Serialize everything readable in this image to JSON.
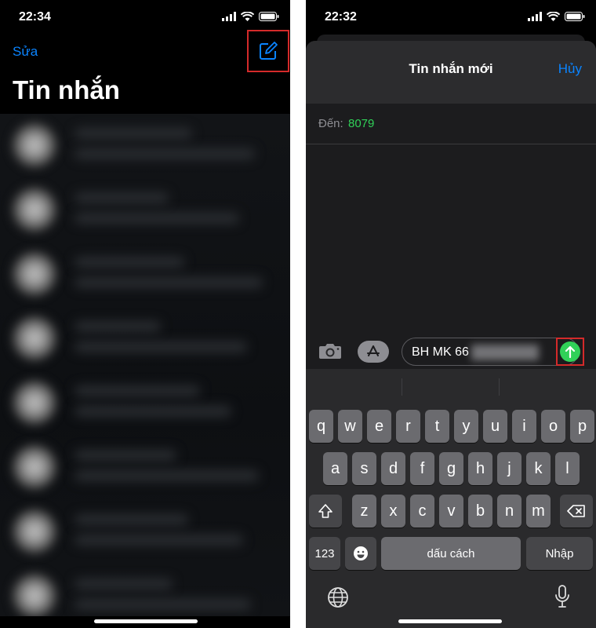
{
  "left_screen": {
    "status_time": "22:34",
    "edit_label": "Sửa",
    "title": "Tin nhắn",
    "compose_icon": "compose-icon"
  },
  "right_screen": {
    "status_time": "22:32",
    "sheet_title": "Tin nhắn mới",
    "cancel_label": "Hủy",
    "to_label": "Đến:",
    "to_value": "8079",
    "message_text": "BH MK 66",
    "keyboard": {
      "row1": [
        "q",
        "w",
        "e",
        "r",
        "t",
        "y",
        "u",
        "i",
        "o",
        "p"
      ],
      "row2": [
        "a",
        "s",
        "d",
        "f",
        "g",
        "h",
        "j",
        "k",
        "l"
      ],
      "row3": [
        "z",
        "x",
        "c",
        "v",
        "b",
        "n",
        "m"
      ],
      "numbers_label": "123",
      "space_label": "dấu cách",
      "return_label": "Nhập"
    }
  },
  "colors": {
    "link_blue": "#0a84ff",
    "recipient_green": "#30d158",
    "highlight_red": "#d42a2a"
  }
}
